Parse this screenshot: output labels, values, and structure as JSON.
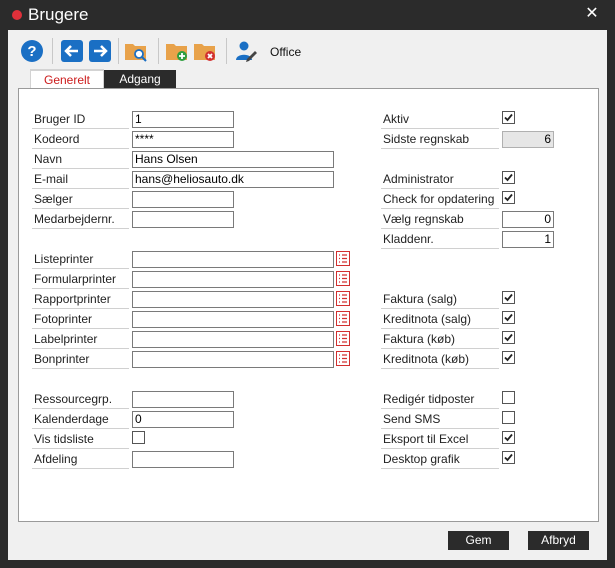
{
  "window": {
    "title": "Brugere"
  },
  "toolbar": {
    "office_label": "Office"
  },
  "tabs": [
    {
      "label": "Generelt"
    },
    {
      "label": "Adgang"
    }
  ],
  "left_fields": [
    {
      "label": "Bruger ID",
      "value": "1"
    },
    {
      "label": "Kodeord",
      "value": "****"
    },
    {
      "label": "Navn",
      "value": "Hans Olsen"
    },
    {
      "label": "E-mail",
      "value": "hans@heliosauto.dk"
    },
    {
      "label": "Sælger",
      "value": ""
    },
    {
      "label": "Medarbejdernr.",
      "value": ""
    },
    {
      "label": "Listeprinter",
      "value": ""
    },
    {
      "label": "Formularprinter",
      "value": ""
    },
    {
      "label": "Rapportprinter",
      "value": ""
    },
    {
      "label": "Fotoprinter",
      "value": ""
    },
    {
      "label": "Labelprinter",
      "value": ""
    },
    {
      "label": "Bonprinter",
      "value": ""
    },
    {
      "label": "Ressourcegrp.",
      "value": ""
    },
    {
      "label": "Kalenderdage",
      "value": "0"
    },
    {
      "label": "Vis tidsliste",
      "checked": false
    },
    {
      "label": "Afdeling",
      "value": ""
    }
  ],
  "right_fields": [
    {
      "label": "Aktiv",
      "checked": true
    },
    {
      "label": "Sidste regnskab",
      "value": "6"
    },
    {
      "label": "Administrator",
      "checked": true
    },
    {
      "label": "Check for opdatering",
      "checked": true
    },
    {
      "label": "Vælg regnskab",
      "value": "0"
    },
    {
      "label": "Kladdenr.",
      "value": "1"
    },
    {
      "label": "Faktura (salg)",
      "checked": true
    },
    {
      "label": "Kreditnota (salg)",
      "checked": true
    },
    {
      "label": "Faktura (køb)",
      "checked": true
    },
    {
      "label": "Kreditnota (køb)",
      "checked": true
    },
    {
      "label": "Redigér tidposter",
      "checked": false
    },
    {
      "label": "Send SMS",
      "checked": false
    },
    {
      "label": "Eksport til Excel",
      "checked": true
    },
    {
      "label": "Desktop grafik",
      "checked": true
    }
  ],
  "footer": {
    "save_label": "Gem",
    "cancel_label": "Afbryd"
  },
  "colors": {
    "accent_red": "#cc1b1b",
    "dark_bg": "#2b2b2b",
    "toolbar_blue": "#1a6fc4",
    "folder_orange": "#e8a24a"
  }
}
